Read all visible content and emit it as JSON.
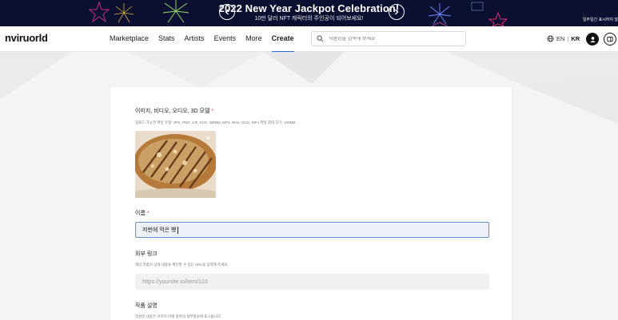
{
  "banner": {
    "title": "2022 New Year Jackpot Celebration!",
    "subtitle": "10만 달러 NFT 캐릭터의 주인공이 되어보세요!",
    "right_text": "일주일간 표시하지 않",
    "prev_icon": "chevron-left-icon",
    "next_icon": "chevron-right-icon"
  },
  "nav": {
    "logo": "nviruorld",
    "menu": [
      {
        "label": "Marketplace",
        "active": false
      },
      {
        "label": "Stats",
        "active": false
      },
      {
        "label": "Artists",
        "active": false
      },
      {
        "label": "Events",
        "active": false
      },
      {
        "label": "More",
        "active": false
      },
      {
        "label": "Create",
        "active": true
      }
    ],
    "search_placeholder": "작품명을 검색해 보세요",
    "lang_en": "EN",
    "lang_sep": "|",
    "lang_kr": "KR"
  },
  "form": {
    "media_label": "이미지, 비디오, 오디오, 3D 모델",
    "required_mark": "*",
    "media_hint": "업로드 가능한 파일 유형: JPG, PNG, GIF, SVG, WEBM, MP3, WAV, OGG, MP4 파일 최대 크기: 100MB",
    "close_symbol": "✕",
    "name_label": "이름",
    "name_value": "저번에 먹은 빵",
    "link_label": "외부 링크",
    "link_hint": "해당 작품의 상세 내용을 확인할 수 있는 URL을 입력해 주세요.",
    "link_placeholder": "https://yoursite.io/item/123",
    "desc_label": "작품 설명",
    "desc_hint": "작성한 내용은 이미지 아래 항목의 세부정보에 표시됩니다."
  },
  "colors": {
    "banner_bg": "#0b1030",
    "accent": "#2c6be0",
    "required": "#e23b3b",
    "name_field_border": "#6a8bd8"
  }
}
